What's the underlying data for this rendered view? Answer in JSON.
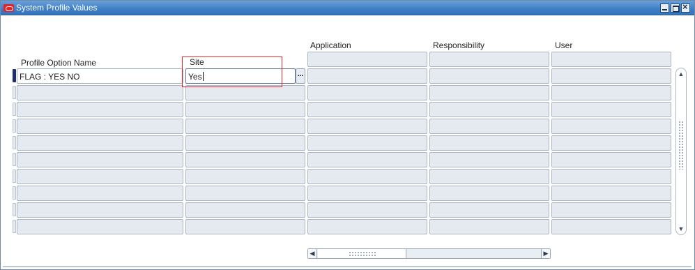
{
  "window": {
    "title": "System Profile Values",
    "logo_icon": "oracle-logo-icon",
    "controls": [
      "minimize-icon",
      "maximize-icon",
      "close-icon"
    ]
  },
  "headers": {
    "profile_option_name": "Profile Option Name",
    "site": "Site",
    "application": "Application",
    "responsibility": "Responsibility",
    "user": "User"
  },
  "rows": [
    {
      "profile_option_name": "FLAG : YES NO",
      "site": "Yes",
      "application": "",
      "responsibility": "",
      "user": ""
    },
    {
      "profile_option_name": "",
      "site": "",
      "application": "",
      "responsibility": "",
      "user": ""
    },
    {
      "profile_option_name": "",
      "site": "",
      "application": "",
      "responsibility": "",
      "user": ""
    },
    {
      "profile_option_name": "",
      "site": "",
      "application": "",
      "responsibility": "",
      "user": ""
    },
    {
      "profile_option_name": "",
      "site": "",
      "application": "",
      "responsibility": "",
      "user": ""
    },
    {
      "profile_option_name": "",
      "site": "",
      "application": "",
      "responsibility": "",
      "user": ""
    },
    {
      "profile_option_name": "",
      "site": "",
      "application": "",
      "responsibility": "",
      "user": ""
    },
    {
      "profile_option_name": "",
      "site": "",
      "application": "",
      "responsibility": "",
      "user": ""
    },
    {
      "profile_option_name": "",
      "site": "",
      "application": "",
      "responsibility": "",
      "user": ""
    },
    {
      "profile_option_name": "",
      "site": "",
      "application": "",
      "responsibility": "",
      "user": ""
    }
  ],
  "lov_button_label": "...",
  "colors": {
    "title_bar": "#3f7fc7",
    "focus_outline": "#e0242a",
    "current_record_indicator": "#1d2f73"
  }
}
